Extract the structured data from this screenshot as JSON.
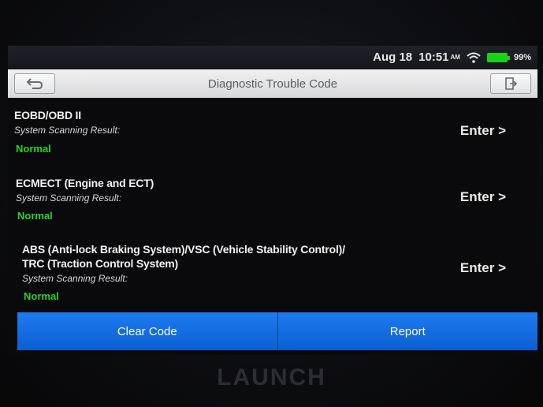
{
  "status": {
    "date": "Aug 18",
    "time": "10:51",
    "ampm": "AM",
    "battery": "99%"
  },
  "header": {
    "title": "Diagnostic Trouble Code"
  },
  "systems": [
    {
      "name": "EOBD/OBD II",
      "sub": "System Scanning Result:",
      "status": "Normal",
      "action": "Enter >"
    },
    {
      "name": "ECMECT (Engine and ECT)",
      "sub": "System Scanning Result:",
      "status": "Normal",
      "action": "Enter >"
    },
    {
      "name": "ABS (Anti-lock Braking System)/VSC (Vehicle Stability Control)/",
      "name2": "TRC (Traction Control System)",
      "sub": "System Scanning Result:",
      "status": "Normal",
      "action": "Enter >"
    }
  ],
  "footer": {
    "clear_label": "Clear Code",
    "report_label": "Report"
  },
  "device": {
    "brand": "LAUNCH"
  },
  "colors": {
    "accent": "#1d7bf0",
    "normal": "#29d02a"
  }
}
